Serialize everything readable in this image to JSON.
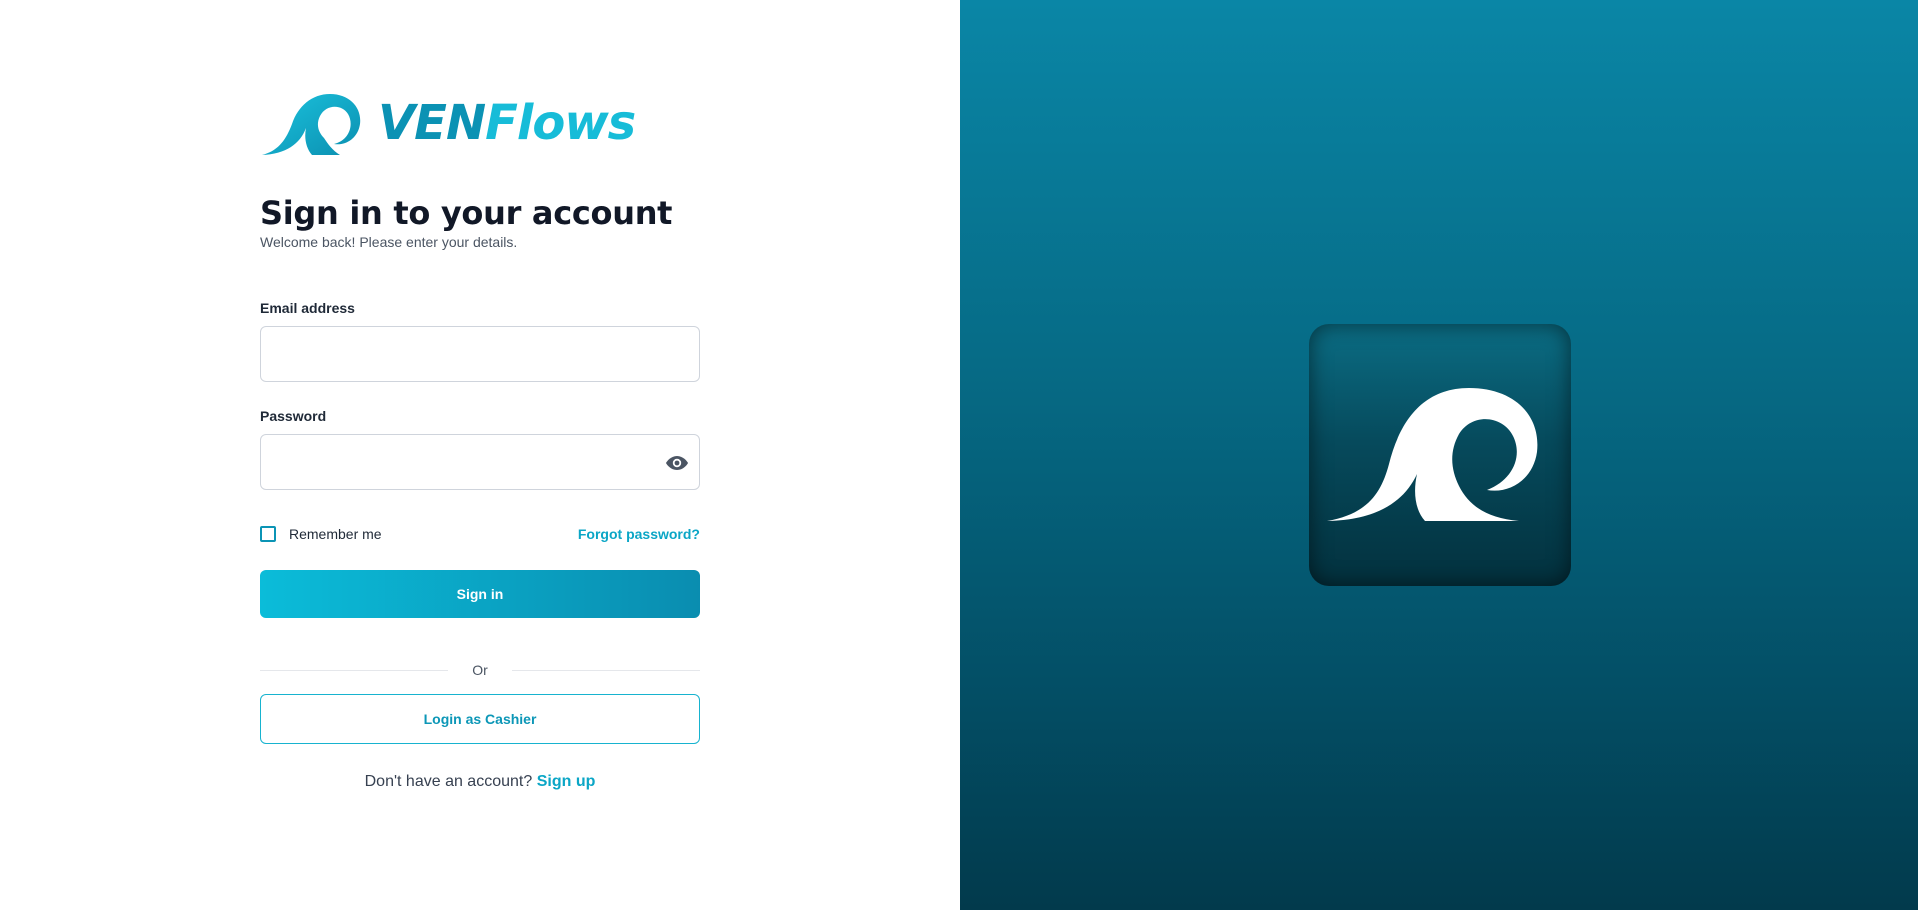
{
  "brand": {
    "logo_part1": "VEN",
    "logo_part2": "Flows",
    "icon": "wave-logo-icon",
    "color_dark": "#0b92b4",
    "color_light": "#17bcd8"
  },
  "signin": {
    "title": "Sign in to your account",
    "subtitle": "Welcome back! Please enter your details.",
    "email_label": "Email address",
    "email_value": "",
    "password_label": "Password",
    "password_value": "",
    "password_toggle_icon": "eye-icon",
    "remember_label": "Remember me",
    "remember_checked": false,
    "forgot_label": "Forgot password?",
    "submit_label": "Sign in",
    "divider_label": "Or",
    "cashier_label": "Login as Cashier",
    "signup_prompt": "Don't have an account?",
    "signup_link": "Sign up"
  },
  "hero": {
    "icon": "wave-logo-icon",
    "accent": "#0a86a6"
  }
}
